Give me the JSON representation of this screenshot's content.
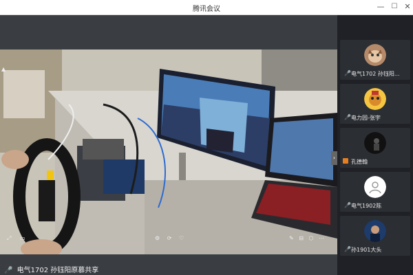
{
  "window": {
    "title": "腾讯会议",
    "min_label": "—",
    "max_label": "☐",
    "close_label": "✕"
  },
  "main_video": {
    "participant_name": "电气1702 孙钰阳原慕共享",
    "controls_left": [
      "⤢",
      "▭"
    ],
    "controls_mid": [
      "⚙",
      "⟳",
      "♡"
    ],
    "controls_right": [
      "✎",
      "⊟",
      "⬡",
      "⋯"
    ],
    "collapse_label": "›",
    "corner_label": "▲"
  },
  "participants": [
    {
      "name": "电气1702 孙钰阳...",
      "muted": false,
      "avatar": "cat-photo"
    },
    {
      "name": "电力园-张宇",
      "muted": false,
      "avatar": "cartoon-character"
    },
    {
      "name": "孔德翰",
      "muted": true,
      "camera_off": true,
      "avatar": "dark-figure"
    },
    {
      "name": "电气1902陈",
      "muted": false,
      "avatar": "white-avatar"
    },
    {
      "name": "孙1901大头",
      "muted": false,
      "avatar": "blue-portrait"
    }
  ],
  "colors": {
    "accent": "#2d8cf0",
    "sidebar_bg": "#1f2126",
    "tile_bg": "#2b2e33",
    "camera_off": "#e67e22"
  }
}
